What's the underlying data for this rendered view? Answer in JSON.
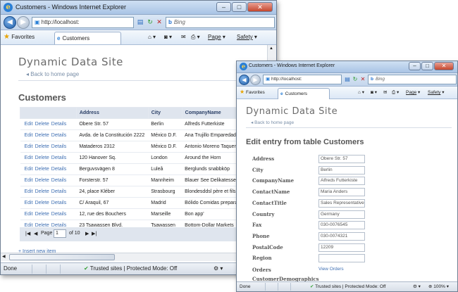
{
  "window1": {
    "title": "Customers - Windows Internet Explorer",
    "url": "http://localhost:",
    "search_placeholder": "Bing",
    "favorites_label": "Favorites",
    "tab_label": "Customers",
    "cmd_page": "Page",
    "cmd_safety": "Safety",
    "site_title": "Dynamic Data Site",
    "home_link": "Back to home page",
    "page_heading": "Customers",
    "columns": [
      "Address",
      "City",
      "CompanyName"
    ],
    "row_actions": [
      "Edit",
      "Delete",
      "Details"
    ],
    "rows": [
      {
        "address": "Obere Str. 57",
        "city": "Berlin",
        "company": "Alfreds Futterkiste"
      },
      {
        "address": "Avda. de la Constitución 2222",
        "city": "México D.F.",
        "company": "Ana Trujillo Emparedados"
      },
      {
        "address": "Mataderos 2312",
        "city": "México D.F.",
        "company": "Antonio Moreno Taqueria"
      },
      {
        "address": "120 Hanover Sq.",
        "city": "London",
        "company": "Around the Horn"
      },
      {
        "address": "Berguvsvägen 8",
        "city": "Luleå",
        "company": "Berglunds snabbköp"
      },
      {
        "address": "Forsterstr. 57",
        "city": "Mannheim",
        "company": "Blauer See Delikatessen"
      },
      {
        "address": "24, place Kléber",
        "city": "Strasbourg",
        "company": "Blondesddsl père et fils"
      },
      {
        "address": "C/ Araquil, 67",
        "city": "Madrid",
        "company": "Bólido Comidas preparada"
      },
      {
        "address": "12, rue des Bouchers",
        "city": "Marseille",
        "company": "Bon app'"
      },
      {
        "address": "23 Tsawassen Blvd.",
        "city": "Tsawassen",
        "company": "Bottom-Dollar Markets"
      }
    ],
    "pager": {
      "page_label": "Page",
      "page_value": "1",
      "of_label": "of 10"
    },
    "insert_link": "Insert new item",
    "status_done": "Done",
    "status_zone": "Trusted sites | Protected Mode: Off"
  },
  "window2": {
    "title": "Customers - Windows Internet Explorer",
    "url": "http://localhost:",
    "search_placeholder": "Bing",
    "favorites_label": "Favorites",
    "tab_label": "Customers",
    "cmd_page": "Page",
    "cmd_safety": "Safety",
    "site_title": "Dynamic Data Site",
    "home_link": "Back to home page",
    "page_heading": "Edit entry from table Customers",
    "fields": [
      {
        "label": "Address",
        "value": "Obere Str. 57"
      },
      {
        "label": "City",
        "value": "Berlin"
      },
      {
        "label": "CompanyName",
        "value": "Alfreds Futterkiste"
      },
      {
        "label": "ContactName",
        "value": "Maria Anders"
      },
      {
        "label": "ContactTitle",
        "value": "Sales Representative"
      },
      {
        "label": "Country",
        "value": "Germany"
      },
      {
        "label": "Fax",
        "value": "030-0076545"
      },
      {
        "label": "Phone",
        "value": "030-0074321"
      },
      {
        "label": "PostalCode",
        "value": "12209"
      },
      {
        "label": "Region",
        "value": ""
      }
    ],
    "orders_label": "Orders",
    "orders_link": "View Orders",
    "demographics_label": "CustomerDemographics",
    "status_done": "Done",
    "status_zone": "Trusted sites | Protected Mode: Off",
    "zoom": "100%"
  }
}
